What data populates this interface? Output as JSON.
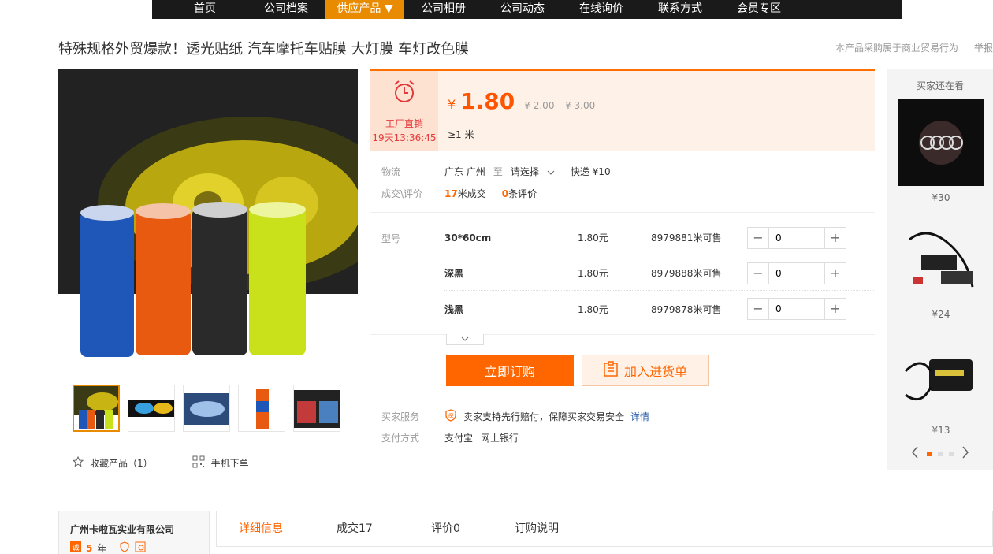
{
  "nav": [
    "首页",
    "公司档案",
    "供应产品 ▼",
    "公司相册",
    "公司动态",
    "在线询价",
    "联系方式",
    "会员专区"
  ],
  "title": "特殊规格外贸爆款！透光贴纸 汽车摩托车贴膜 大灯膜 车灯改色膜",
  "right_links": {
    "trade_note": "本产品采购属于商业贸易行为",
    "report": "举报"
  },
  "promo": {
    "label": "工厂直销",
    "countdown": "19天13:36:45"
  },
  "price": {
    "currency": "¥",
    "value": "1.80",
    "original": "¥ 2.00 – ¥ 3.00",
    "moq": "≥1 米"
  },
  "logistics": {
    "key": "物流",
    "from": "广东 广州",
    "to_word": "至",
    "dest": "请选择",
    "express": "快递 ¥10"
  },
  "deals": {
    "key": "成交\\评价",
    "count": "17",
    "count_suffix": "米成交",
    "reviews": "0",
    "reviews_suffix": "条评价"
  },
  "sku_label": "型号",
  "skus": [
    {
      "name": "30*60cm",
      "price": "1.80元",
      "stock": "8979881米可售",
      "qty": "0"
    },
    {
      "name": "深黑",
      "price": "1.80元",
      "stock": "8979888米可售",
      "qty": "0"
    },
    {
      "name": "浅黑",
      "price": "1.80元",
      "stock": "8979878米可售",
      "qty": "0"
    }
  ],
  "buy_label": "立即订购",
  "cart_label": "加入进货单",
  "service": {
    "key": "买家服务",
    "text": "卖家支持先行赔付，保障买家交易安全",
    "link": "详情"
  },
  "payment": {
    "key": "支付方式",
    "methods": [
      "支付宝",
      "网上银行"
    ]
  },
  "favorite": {
    "label": "收藏产品（1）",
    "mobile": "手机下单"
  },
  "sidebar": {
    "title": "买家还在看",
    "items": [
      {
        "price": "¥30"
      },
      {
        "price": "¥24"
      },
      {
        "price": "¥13"
      }
    ]
  },
  "company": {
    "name": "广州卡啦瓦实业有限公司",
    "years": "5",
    "years_suffix": "年"
  },
  "tabs": [
    "详细信息",
    "成交17",
    "评价0",
    "订购说明"
  ],
  "colors": {
    "accent": "#ff6600",
    "nav_bg": "#1a1a1a",
    "nav_active": "#e98b00",
    "promo_bg": "#fef1e8"
  }
}
